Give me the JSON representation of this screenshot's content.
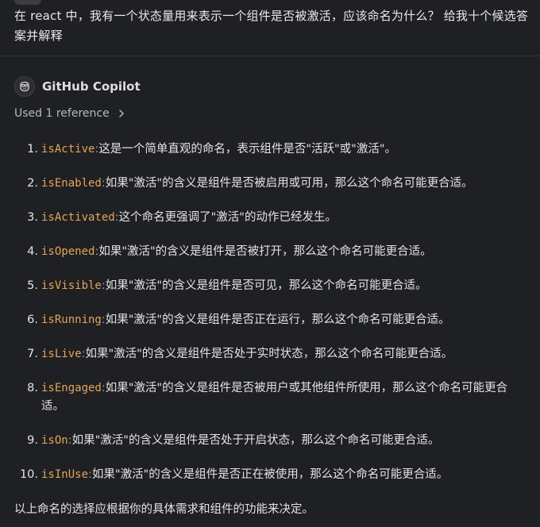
{
  "user_message": {
    "text": "在 react 中，我有一个状态量用来表示一个组件是否被激活，应该命名为什么？ 给我十个候选答案并解释"
  },
  "assistant": {
    "name": "GitHub Copilot",
    "avatar_icon": "copilot-icon",
    "references_label": "Used 1 reference",
    "items": [
      {
        "num": "1.",
        "code": "isActive",
        "sep": ":",
        "desc": "这是一个简单直观的命名，表示组件是否\"活跃\"或\"激活\"。"
      },
      {
        "num": "2.",
        "code": "isEnabled",
        "sep": ":",
        "desc": "如果\"激活\"的含义是组件是否被启用或可用，那么这个命名可能更合适。"
      },
      {
        "num": "3.",
        "code": "isActivated",
        "sep": ":",
        "desc": "这个命名更强调了\"激活\"的动作已经发生。"
      },
      {
        "num": "4.",
        "code": "isOpened",
        "sep": ":",
        "desc": "如果\"激活\"的含义是组件是否被打开，那么这个命名可能更合适。"
      },
      {
        "num": "5.",
        "code": "isVisible",
        "sep": ":",
        "desc": "如果\"激活\"的含义是组件是否可见，那么这个命名可能更合适。"
      },
      {
        "num": "6.",
        "code": "isRunning",
        "sep": ":",
        "desc": "如果\"激活\"的含义是组件是否正在运行，那么这个命名可能更合适。"
      },
      {
        "num": "7.",
        "code": "isLive",
        "sep": ":",
        "desc": "如果\"激活\"的含义是组件是否处于实时状态，那么这个命名可能更合适。"
      },
      {
        "num": "8.",
        "code": "isEngaged",
        "sep": ":",
        "desc": "如果\"激活\"的含义是组件是否被用户或其他组件所使用，那么这个命名可能更合适。"
      },
      {
        "num": "9.",
        "code": "isOn",
        "sep": ":",
        "desc": "如果\"激活\"的含义是组件是否处于开启状态，那么这个命名可能更合适。"
      },
      {
        "num": "10.",
        "code": "isInUse",
        "sep": ":",
        "desc": "如果\"激活\"的含义是组件是否正在被使用，那么这个命名可能更合适。"
      }
    ],
    "conclusion": "以上命名的选择应根据你的具体需求和组件的功能来决定。"
  },
  "colors": {
    "background": "#1f2023",
    "text": "#e4e4e4",
    "code": "#e2a45a",
    "muted": "#b7b9bd",
    "divider": "#34363b"
  }
}
